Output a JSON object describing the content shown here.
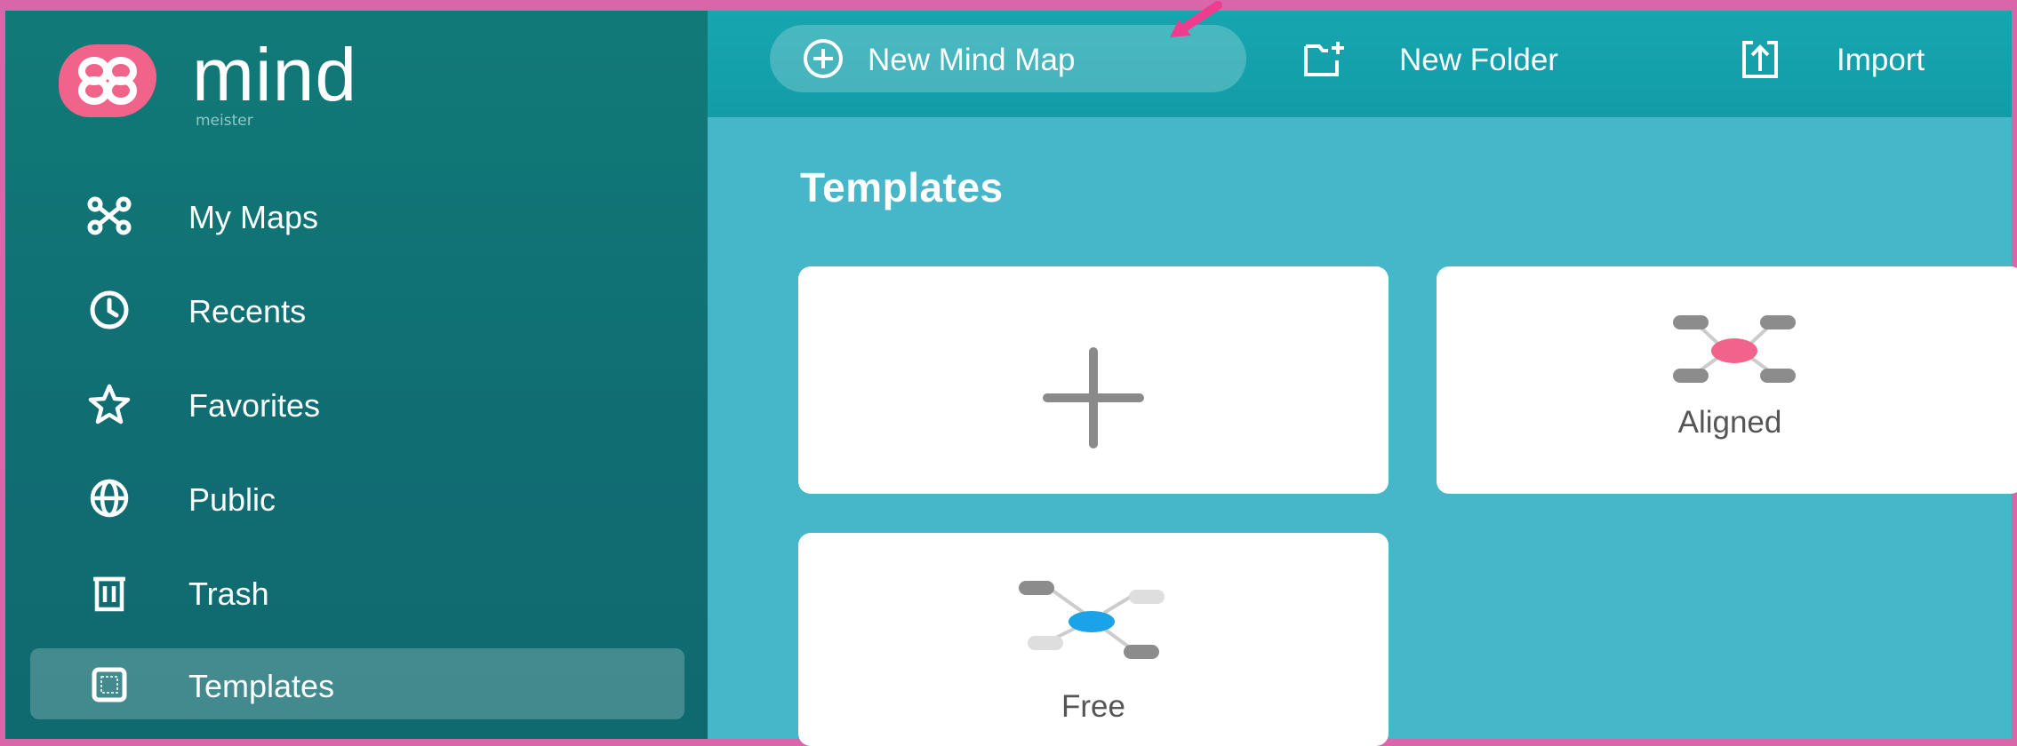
{
  "app": {
    "logo_word": "mind",
    "logo_sub": "meister"
  },
  "sidebar": {
    "items": [
      {
        "label": "My Maps",
        "icon": "mind-map-icon",
        "active": false
      },
      {
        "label": "Recents",
        "icon": "clock-icon",
        "active": false
      },
      {
        "label": "Favorites",
        "icon": "star-icon",
        "active": false
      },
      {
        "label": "Public",
        "icon": "globe-icon",
        "active": false
      },
      {
        "label": "Trash",
        "icon": "trash-icon",
        "active": false
      },
      {
        "label": "Templates",
        "icon": "template-icon",
        "active": true
      }
    ]
  },
  "toolbar": {
    "new_mind_map": "New Mind Map",
    "new_folder": "New Folder",
    "import": "Import"
  },
  "main": {
    "title": "Templates",
    "templates": [
      {
        "label": "",
        "icon": "plus-icon"
      },
      {
        "label": "Aligned",
        "icon": "aligned-map-icon"
      },
      {
        "label": "Free",
        "icon": "free-map-icon"
      }
    ]
  },
  "colors": {
    "frame": "#d866a8",
    "sidebar": "#117a78",
    "toolbar": "#16a6b0",
    "content": "#45b7c8",
    "logo": "#f0648a",
    "accent_pink": "#f0648a",
    "accent_blue": "#1aa3e8",
    "annotation_arrow": "#ee3d8f"
  }
}
